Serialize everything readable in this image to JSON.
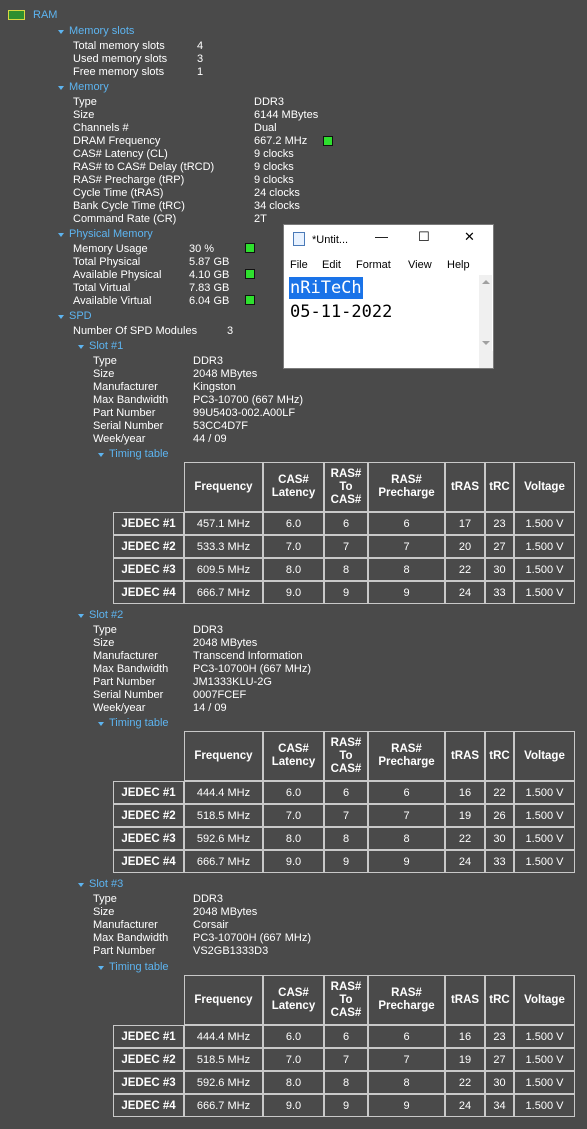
{
  "ram": {
    "title": "RAM"
  },
  "slots": {
    "title": "Memory slots",
    "rows": [
      {
        "label": "Total memory slots",
        "value": "4"
      },
      {
        "label": "Used memory slots",
        "value": "3"
      },
      {
        "label": "Free memory slots",
        "value": "1"
      }
    ]
  },
  "memory": {
    "title": "Memory",
    "rows": [
      {
        "label": "Type",
        "value": "DDR3"
      },
      {
        "label": "Size",
        "value": "6144 MBytes"
      },
      {
        "label": "Channels #",
        "value": "Dual"
      },
      {
        "label": "DRAM Frequency",
        "value": "667.2 MHz"
      },
      {
        "label": "CAS# Latency (CL)",
        "value": "9 clocks"
      },
      {
        "label": "RAS# to CAS# Delay (tRCD)",
        "value": "9 clocks"
      },
      {
        "label": "RAS# Precharge (tRP)",
        "value": "9 clocks"
      },
      {
        "label": "Cycle Time (tRAS)",
        "value": "24 clocks"
      },
      {
        "label": "Bank Cycle Time (tRC)",
        "value": "34 clocks"
      },
      {
        "label": "Command Rate (CR)",
        "value": "2T"
      }
    ]
  },
  "physical": {
    "title": "Physical Memory",
    "rows": [
      {
        "label": "Memory Usage",
        "value": "30 %"
      },
      {
        "label": "Total Physical",
        "value": "5.87 GB"
      },
      {
        "label": "Available Physical",
        "value": "4.10 GB"
      },
      {
        "label": "Total Virtual",
        "value": "7.83 GB"
      },
      {
        "label": "Available Virtual",
        "value": "6.04 GB"
      }
    ]
  },
  "spd": {
    "title": "SPD",
    "modules_label": "Number Of SPD Modules",
    "modules_value": "3",
    "timing_title": "Timing table",
    "headers": [
      "Frequency",
      "CAS# Latency",
      "RAS# To CAS#",
      "RAS# Precharge",
      "tRAS",
      "tRC",
      "Voltage"
    ],
    "slot1": {
      "title": "Slot #1",
      "rows": [
        {
          "label": "Type",
          "value": "DDR3"
        },
        {
          "label": "Size",
          "value": "2048 MBytes"
        },
        {
          "label": "Manufacturer",
          "value": "Kingston"
        },
        {
          "label": "Max Bandwidth",
          "value": "PC3-10700 (667 MHz)"
        },
        {
          "label": "Part Number",
          "value": "99U5403-002.A00LF"
        },
        {
          "label": "Serial Number",
          "value": "53CC4D7F"
        },
        {
          "label": "Week/year",
          "value": "44 / 09"
        }
      ],
      "timings": [
        [
          "JEDEC #1",
          "457.1 MHz",
          "6.0",
          "6",
          "6",
          "17",
          "23",
          "1.500 V"
        ],
        [
          "JEDEC #2",
          "533.3 MHz",
          "7.0",
          "7",
          "7",
          "20",
          "27",
          "1.500 V"
        ],
        [
          "JEDEC #3",
          "609.5 MHz",
          "8.0",
          "8",
          "8",
          "22",
          "30",
          "1.500 V"
        ],
        [
          "JEDEC #4",
          "666.7 MHz",
          "9.0",
          "9",
          "9",
          "24",
          "33",
          "1.500 V"
        ]
      ]
    },
    "slot2": {
      "title": "Slot #2",
      "rows": [
        {
          "label": "Type",
          "value": "DDR3"
        },
        {
          "label": "Size",
          "value": "2048 MBytes"
        },
        {
          "label": "Manufacturer",
          "value": "Transcend Information"
        },
        {
          "label": "Max Bandwidth",
          "value": "PC3-10700H (667 MHz)"
        },
        {
          "label": "Part Number",
          "value": "JM1333KLU-2G"
        },
        {
          "label": "Serial Number",
          "value": "0007FCEF"
        },
        {
          "label": "Week/year",
          "value": "14 / 09"
        }
      ],
      "timings": [
        [
          "JEDEC #1",
          "444.4 MHz",
          "6.0",
          "6",
          "6",
          "16",
          "22",
          "1.500 V"
        ],
        [
          "JEDEC #2",
          "518.5 MHz",
          "7.0",
          "7",
          "7",
          "19",
          "26",
          "1.500 V"
        ],
        [
          "JEDEC #3",
          "592.6 MHz",
          "8.0",
          "8",
          "8",
          "22",
          "30",
          "1.500 V"
        ],
        [
          "JEDEC #4",
          "666.7 MHz",
          "9.0",
          "9",
          "9",
          "24",
          "33",
          "1.500 V"
        ]
      ]
    },
    "slot3": {
      "title": "Slot #3",
      "rows": [
        {
          "label": "Type",
          "value": "DDR3"
        },
        {
          "label": "Size",
          "value": "2048 MBytes"
        },
        {
          "label": "Manufacturer",
          "value": "Corsair"
        },
        {
          "label": "Max Bandwidth",
          "value": "PC3-10700H (667 MHz)"
        },
        {
          "label": "Part Number",
          "value": "VS2GB1333D3"
        }
      ],
      "timings": [
        [
          "JEDEC #1",
          "444.4 MHz",
          "6.0",
          "6",
          "6",
          "16",
          "23",
          "1.500 V"
        ],
        [
          "JEDEC #2",
          "518.5 MHz",
          "7.0",
          "7",
          "7",
          "19",
          "27",
          "1.500 V"
        ],
        [
          "JEDEC #3",
          "592.6 MHz",
          "8.0",
          "8",
          "8",
          "22",
          "30",
          "1.500 V"
        ],
        [
          "JEDEC #4",
          "666.7 MHz",
          "9.0",
          "9",
          "9",
          "24",
          "34",
          "1.500 V"
        ]
      ]
    }
  },
  "notepad": {
    "title": "*Untit...",
    "minimize": "—",
    "maximize": "☐",
    "close": "✕",
    "menu": [
      "File",
      "Edit",
      "Format",
      "View",
      "Help"
    ],
    "line1": "nRiTeCh",
    "line2": "05-11-2022"
  },
  "colors": {
    "header": "#5db4f0",
    "indicator": "#2ee02e",
    "background": "#4a4a4a"
  }
}
